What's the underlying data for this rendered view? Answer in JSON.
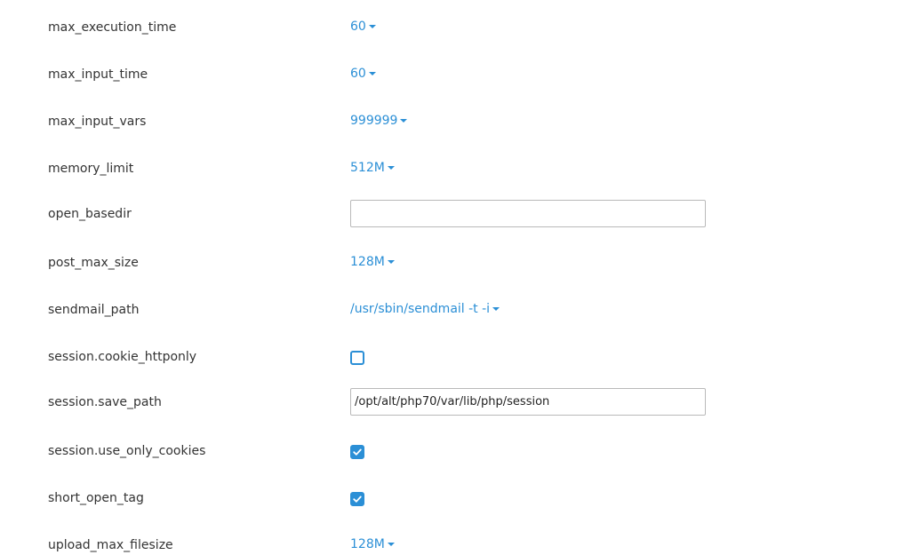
{
  "settings": [
    {
      "label": "max_execution_time",
      "type": "dropdown",
      "value": "60"
    },
    {
      "label": "max_input_time",
      "type": "dropdown",
      "value": "60"
    },
    {
      "label": "max_input_vars",
      "type": "dropdown",
      "value": "999999"
    },
    {
      "label": "memory_limit",
      "type": "dropdown",
      "value": "512M"
    },
    {
      "label": "open_basedir",
      "type": "text",
      "value": ""
    },
    {
      "label": "post_max_size",
      "type": "dropdown",
      "value": "128M"
    },
    {
      "label": "sendmail_path",
      "type": "dropdown",
      "value": "/usr/sbin/sendmail -t -i"
    },
    {
      "label": "session.cookie_httponly",
      "type": "checkbox",
      "checked": false
    },
    {
      "label": "session.save_path",
      "type": "text",
      "value": "/opt/alt/php70/var/lib/php/session"
    },
    {
      "label": "session.use_only_cookies",
      "type": "checkbox",
      "checked": true
    },
    {
      "label": "short_open_tag",
      "type": "checkbox",
      "checked": true
    },
    {
      "label": "upload_max_filesize",
      "type": "dropdown",
      "value": "128M"
    }
  ],
  "colors": {
    "accent": "#2b8fd6",
    "label_text": "#333333",
    "input_border": "#b9b9b9"
  },
  "icons": {
    "dropdown": "caret-down-icon",
    "checkbox_checked": "checkmark-icon"
  }
}
